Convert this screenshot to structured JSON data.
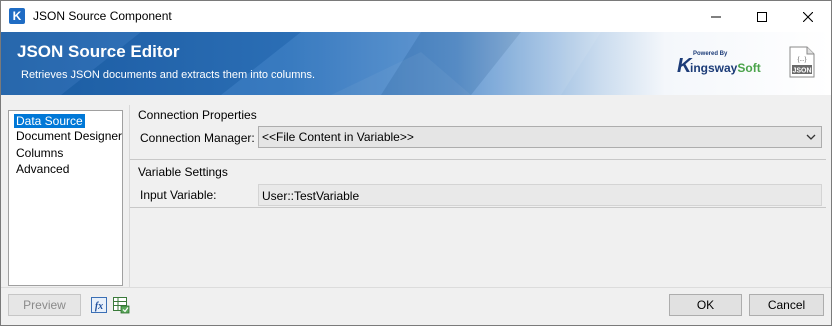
{
  "window": {
    "app_icon_letter": "K",
    "title": "JSON Source Component"
  },
  "banner": {
    "title": "JSON Source Editor",
    "subtitle": "Retrieves JSON documents and extracts them into columns.",
    "brand_powered": "Powered By",
    "brand_k": "K",
    "brand_name_main": "ingsway",
    "brand_name_soft": "Soft",
    "file_icon_label": "JSON",
    "file_icon_glyph": "{...}"
  },
  "nav": {
    "items": [
      {
        "label": "Data Source",
        "selected": true
      },
      {
        "label": "Document Designer",
        "selected": false
      },
      {
        "label": "Columns",
        "selected": false
      },
      {
        "label": "Advanced",
        "selected": false
      }
    ]
  },
  "connection": {
    "header": "Connection Properties",
    "manager_label": "Connection Manager:",
    "manager_value": "<<File Content in Variable>>"
  },
  "variable": {
    "header": "Variable Settings",
    "input_label": "Input Variable:",
    "input_value": "User::TestVariable"
  },
  "footer": {
    "preview_label": "Preview",
    "ok_label": "OK",
    "cancel_label": "Cancel"
  },
  "colors": {
    "banner_blue": "#1c5fa8",
    "selection": "#0078d7",
    "brand_green": "#4aa34a"
  }
}
